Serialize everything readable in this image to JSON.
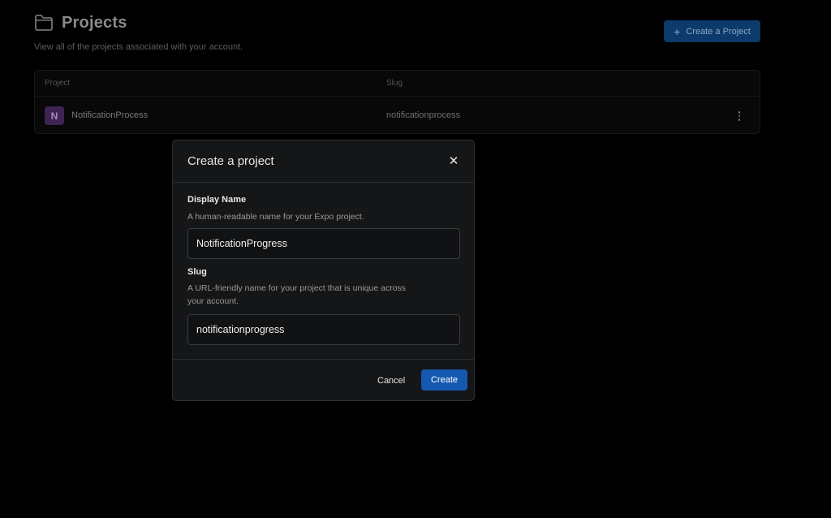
{
  "page": {
    "title": "Projects",
    "subtitle": "View all of the projects associated with your account.",
    "create_button_label": "Create a Project"
  },
  "table": {
    "columns": [
      "Project",
      "Slug"
    ],
    "rows": [
      {
        "initial": "N",
        "name": "NotificationProcess",
        "slug": "notificationprocess"
      }
    ]
  },
  "modal": {
    "title": "Create a project",
    "close_glyph": "✕",
    "display_name": {
      "label": "Display Name",
      "help": "A human-readable name for your Expo project.",
      "value": "NotificationProgress"
    },
    "slug": {
      "label": "Slug",
      "help_line1": "A URL-friendly name for your project that is unique across",
      "help_line2": "your account.",
      "value": "notificationprogress"
    },
    "cancel_label": "Cancel",
    "create_label": "Create"
  },
  "colors": {
    "primary": "#1558b0",
    "avatar_bg": "#3d2452",
    "background": "#000000",
    "modal_bg": "#151617"
  },
  "icons": [
    "folder-icon",
    "plus-icon",
    "more-vertical-icon",
    "close-icon"
  ]
}
